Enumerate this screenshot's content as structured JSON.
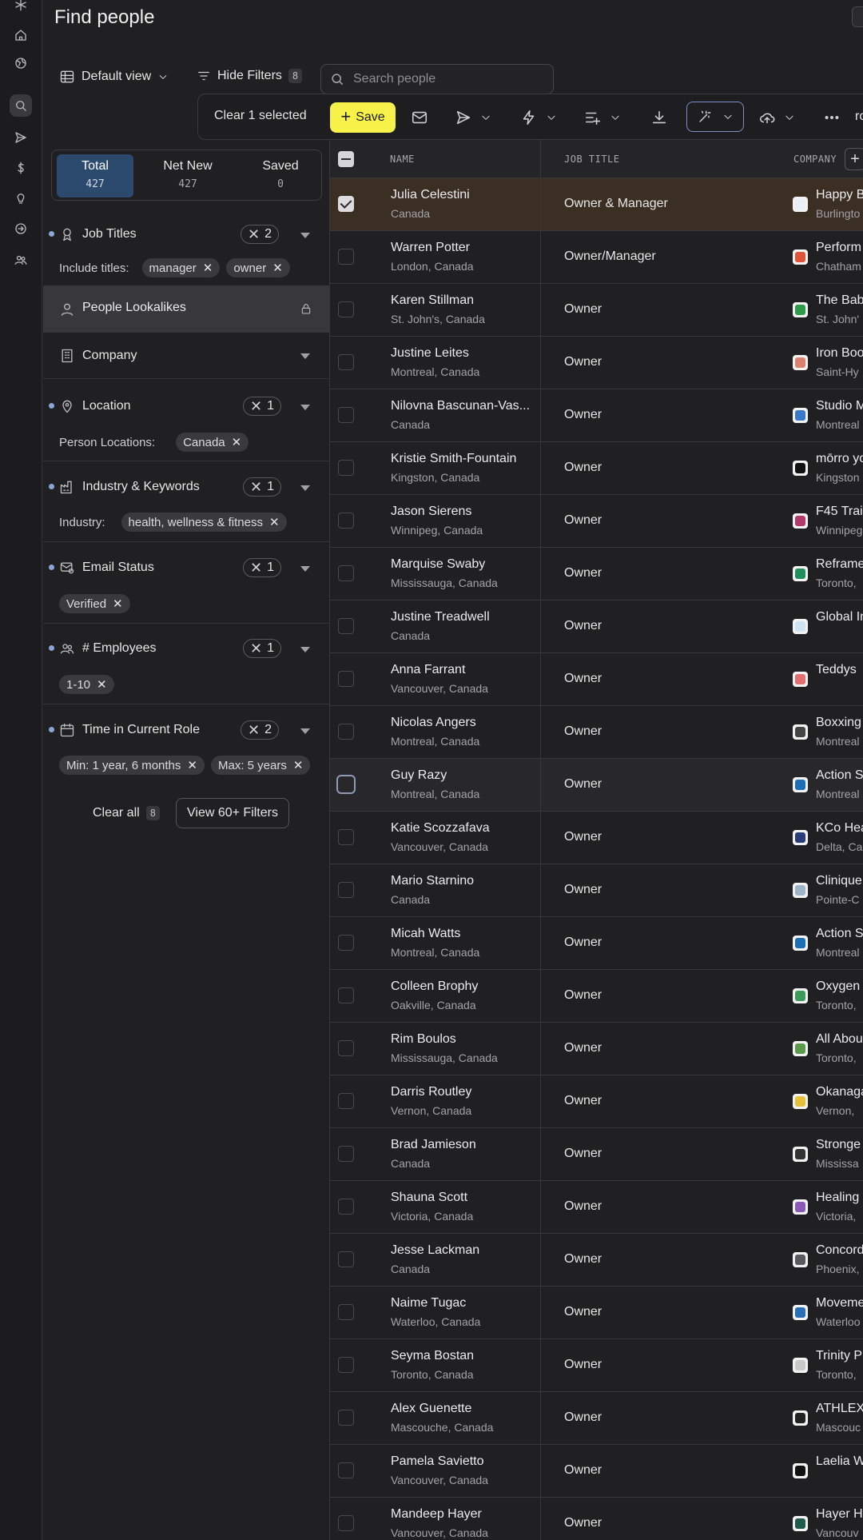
{
  "page": {
    "title": "Find people"
  },
  "toolbar": {
    "view_label": "Default view",
    "hide_filters_label": "Hide Filters",
    "hide_filters_count": "8",
    "search_placeholder": "Search people"
  },
  "actions": {
    "clear_selected": "Clear 1 selected",
    "save_label": "Save",
    "trailing_text": "ro"
  },
  "stats": [
    {
      "label": "Total",
      "value": "427"
    },
    {
      "label": "Net New",
      "value": "427"
    },
    {
      "label": "Saved",
      "value": "0"
    }
  ],
  "filters": {
    "job_titles": {
      "name": "Job Titles",
      "count": "2",
      "sub_label": "Include titles:",
      "chips": [
        "manager",
        "owner"
      ]
    },
    "lookalikes": {
      "name": "People Lookalikes"
    },
    "company": {
      "name": "Company"
    },
    "location": {
      "name": "Location",
      "count": "1",
      "sub_label": "Person Locations:",
      "chips": [
        "Canada"
      ]
    },
    "industry": {
      "name": "Industry & Keywords",
      "count": "1",
      "sub_label": "Industry:",
      "chips": [
        "health, wellness & fitness"
      ]
    },
    "email": {
      "name": "Email Status",
      "count": "1",
      "chips": [
        "Verified"
      ]
    },
    "employees": {
      "name": "# Employees",
      "count": "1",
      "chips": [
        "1-10"
      ]
    },
    "time_in_role": {
      "name": "Time in Current Role",
      "count": "2",
      "chips": [
        "Min: 1 year, 6 months",
        "Max: 5 years"
      ]
    },
    "clear_all": "Clear all",
    "clear_all_count": "8",
    "more_filters": "View 60+ Filters"
  },
  "table": {
    "columns": [
      "NAME",
      "JOB TITLE",
      "COMPANY"
    ],
    "rows": [
      {
        "name": "Julia Celestini",
        "location": "Canada",
        "title": "Owner & Manager",
        "company": "Happy B",
        "company_location": "Burlingto",
        "selected": true,
        "logo_color": "#e9eef7"
      },
      {
        "name": "Warren Potter",
        "location": "London, Canada",
        "title": "Owner/Manager",
        "company": "Perform",
        "company_location": "Chatham",
        "logo_color": "#e0553a"
      },
      {
        "name": "Karen Stillman",
        "location": "St. John's, Canada",
        "title": "Owner",
        "company": "The Bab",
        "company_location": "St. John'",
        "logo_color": "#2f9a4a"
      },
      {
        "name": "Justine Leites",
        "location": "Montreal, Canada",
        "title": "Owner",
        "company": "Iron Boo",
        "company_location": "Saint-Hy",
        "logo_color": "#d9826f"
      },
      {
        "name": "Nilovna Bascunan-Vas...",
        "location": "Canada",
        "title": "Owner",
        "company": "Studio M",
        "company_location": "Montreal",
        "logo_color": "#3a78c9"
      },
      {
        "name": "Kristie Smith-Fountain",
        "location": "Kingston, Canada",
        "title": "Owner",
        "company": "mōrro yo",
        "company_location": "Kingston",
        "logo_color": "#111111"
      },
      {
        "name": "Jason Sierens",
        "location": "Winnipeg, Canada",
        "title": "Owner",
        "company": "F45 Trai",
        "company_location": "Winnipeg",
        "logo_color": "#b23a6a"
      },
      {
        "name": "Marquise Swaby",
        "location": "Mississauga, Canada",
        "title": "Owner",
        "company": "Reframe",
        "company_location": "Toronto,",
        "logo_color": "#1f8f5c"
      },
      {
        "name": "Justine Treadwell",
        "location": "Canada",
        "title": "Owner",
        "company": "Global In",
        "company_location": "",
        "logo_color": "#cfe3f2"
      },
      {
        "name": "Anna Farrant",
        "location": "Vancouver, Canada",
        "title": "Owner",
        "company": "Teddys",
        "company_location": "",
        "logo_color": "#e36f6f"
      },
      {
        "name": "Nicolas Angers",
        "location": "Montreal, Canada",
        "title": "Owner",
        "company": "Boxxing",
        "company_location": "Montreal",
        "logo_color": "#444444"
      },
      {
        "name": "Guy Razy",
        "location": "Montreal, Canada",
        "title": "Owner",
        "company": "Action S",
        "company_location": "Montreal",
        "hover": true,
        "logo_color": "#1c6fb5"
      },
      {
        "name": "Katie Scozzafava",
        "location": "Vancouver, Canada",
        "title": "Owner",
        "company": "KCo Hea",
        "company_location": "Delta, Ca",
        "logo_color": "#2b3c7a"
      },
      {
        "name": "Mario Starnino",
        "location": "Canada",
        "title": "Owner",
        "company": "Clinique",
        "company_location": "Pointe-C",
        "logo_color": "#9fb4c9"
      },
      {
        "name": "Micah Watts",
        "location": "Montreal, Canada",
        "title": "Owner",
        "company": "Action S",
        "company_location": "Montreal",
        "logo_color": "#1c6fb5"
      },
      {
        "name": "Colleen Brophy",
        "location": "Oakville, Canada",
        "title": "Owner",
        "company": "Oxygen",
        "company_location": "Toronto,",
        "logo_color": "#3c9a5a"
      },
      {
        "name": "Rim Boulos",
        "location": "Mississauga, Canada",
        "title": "Owner",
        "company": "All Abou",
        "company_location": "Toronto,",
        "logo_color": "#5a9a4a"
      },
      {
        "name": "Darris Routley",
        "location": "Vernon, Canada",
        "title": "Owner",
        "company": "Okanaga",
        "company_location": "Vernon,",
        "logo_color": "#e6c23a"
      },
      {
        "name": "Brad Jamieson",
        "location": "Canada",
        "title": "Owner",
        "company": "Stronge",
        "company_location": "Mississa",
        "logo_color": "#333333"
      },
      {
        "name": "Shauna Scott",
        "location": "Victoria, Canada",
        "title": "Owner",
        "company": "Healing",
        "company_location": "Victoria,",
        "logo_color": "#8a5ab5"
      },
      {
        "name": "Jesse Lackman",
        "location": "Canada",
        "title": "Owner",
        "company": "Concord",
        "company_location": "Phoenix,",
        "logo_color": "#5a5a5e"
      },
      {
        "name": "Naime Tugac",
        "location": "Waterloo, Canada",
        "title": "Owner",
        "company": "Moveme",
        "company_location": "Waterloo",
        "logo_color": "#2a6fb5"
      },
      {
        "name": "Seyma Bostan",
        "location": "Toronto, Canada",
        "title": "Owner",
        "company": "Trinity P",
        "company_location": "Toronto,",
        "logo_color": "#c9c9c9"
      },
      {
        "name": "Alex Guenette",
        "location": "Mascouche, Canada",
        "title": "Owner",
        "company": "ATHLEX",
        "company_location": "Mascouc",
        "logo_color": "#222222"
      },
      {
        "name": "Pamela Savietto",
        "location": "Vancouver, Canada",
        "title": "Owner",
        "company": "Laelia W",
        "company_location": "",
        "logo_color": "#111111"
      },
      {
        "name": "Mandeep Hayer",
        "location": "Vancouver, Canada",
        "title": "Owner",
        "company": "Hayer H",
        "company_location": "Vancouv",
        "logo_color": "#1f5a4a"
      }
    ]
  }
}
